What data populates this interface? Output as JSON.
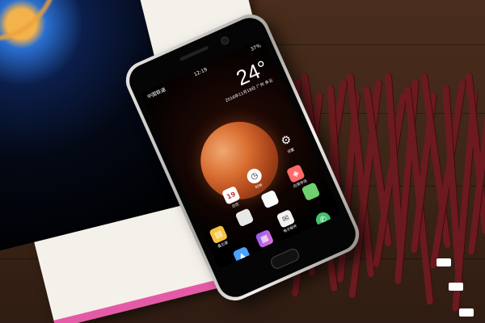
{
  "status_bar": {
    "carrier": "中国联通",
    "time": "12:19",
    "battery": "37%"
  },
  "weather": {
    "temperature": "24°",
    "date": "2016年11月19日",
    "city": "广州",
    "condition": "多云"
  },
  "apps_row1": [
    {
      "label": "日历",
      "icon": "calendar-icon",
      "badge": "19"
    },
    {
      "label": "时钟",
      "icon": "clock-icon"
    },
    {
      "label": "设置",
      "icon": "gear-icon"
    }
  ],
  "apps_row2": [
    {
      "label": "备忘录",
      "icon": "notes-icon"
    },
    {
      "label": "",
      "icon": "placeholder-icon"
    },
    {
      "label": "",
      "icon": "placeholder-icon"
    },
    {
      "label": "应用市场",
      "icon": "store-icon"
    }
  ],
  "apps_row3": [
    {
      "label": "相册",
      "icon": "photos-icon"
    },
    {
      "label": "图库",
      "icon": "gallery-icon"
    },
    {
      "label": "电子邮件",
      "icon": "mail-icon"
    },
    {
      "label": "",
      "icon": "placeholder-icon"
    }
  ],
  "dock": [
    {
      "label": "",
      "icon": "phone-icon"
    },
    {
      "label": "",
      "icon": "camera-icon"
    },
    {
      "label": "",
      "icon": "browser-icon"
    },
    {
      "label": "",
      "icon": "message-icon"
    }
  ],
  "colors": {
    "accent": "#d96e31",
    "dock_phone": "#3fc04f",
    "dock_camera": "#2d6fd6",
    "dock_browser": "#3aa0e8",
    "dock_message": "#42c26a"
  }
}
